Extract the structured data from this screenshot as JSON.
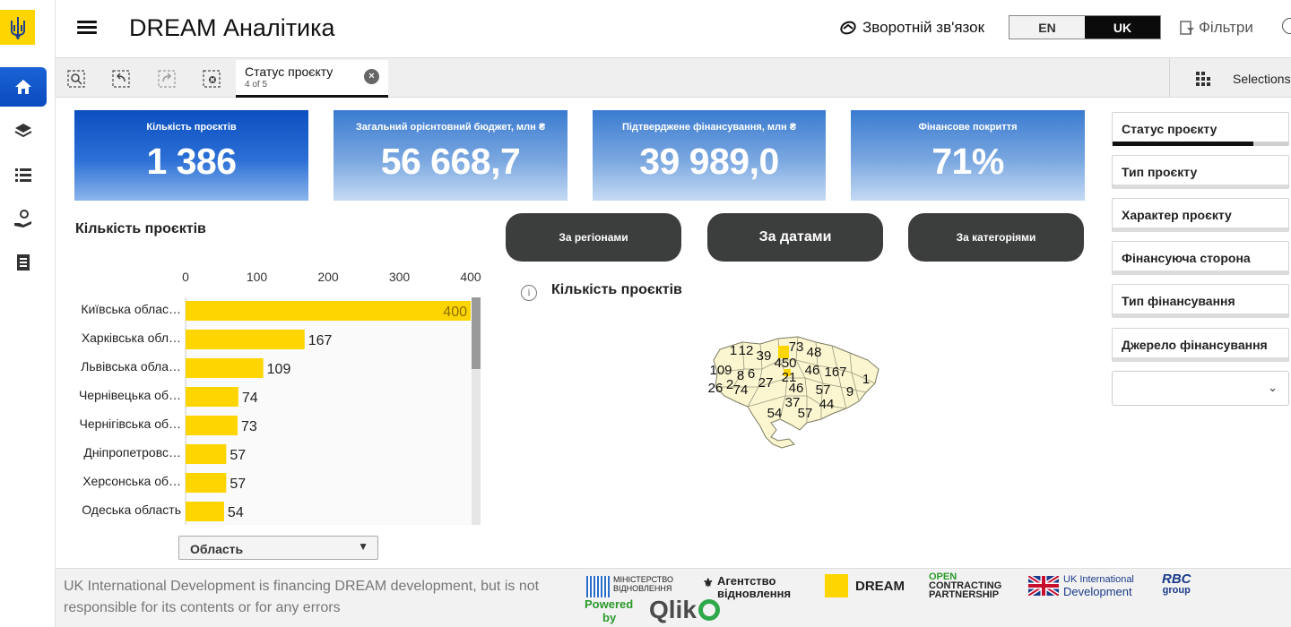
{
  "header": {
    "title": "DREAM Аналітика",
    "feedback": "Зворотній зв'язок",
    "lang_en": "EN",
    "lang_uk": "UK",
    "filters": "Фільтри"
  },
  "toolbar": {
    "tab_title": "Статус проєкту",
    "tab_sub": "4 of 5",
    "selections": "Selections"
  },
  "kpis": [
    {
      "title": "Кількість проєктів",
      "value": "1 386"
    },
    {
      "title": "Загальний орієнтовний бюджет, млн ₴",
      "value": "56 668,7"
    },
    {
      "title": "Підтверджене фінансування, млн ₴",
      "value": "39 989,0"
    },
    {
      "title": "Фінансове покриття",
      "value": "71%"
    }
  ],
  "bar_section": {
    "title": "Кількість проєктів",
    "dimension_select": "Область"
  },
  "buttons": {
    "regions": "За регіонами",
    "dates": "За датами",
    "categories": "За категоріями"
  },
  "map": {
    "title": "Кількість проєктів",
    "labels": [
      "1",
      "12",
      "39",
      "450",
      "73",
      "48",
      "109",
      "8",
      "6",
      "21",
      "46",
      "167",
      "26",
      "2",
      "74",
      "27",
      "46",
      "57",
      "9",
      "1",
      "37",
      "44",
      "54",
      "57"
    ]
  },
  "filters_panel": {
    "items": [
      "Статус проєкту",
      "Тип проєкту",
      "Характер проєкту",
      "Фінансуюча сторона",
      "Тип фінансування",
      "Джерело фінансування"
    ]
  },
  "footer": {
    "disclaimer": "UK International Development is financing DREAM development, but is not responsible for its contents or for any errors",
    "logo_ministry_1": "МІНІСТЕРСТВО",
    "logo_ministry_2": "ВІДНОВЛЕННЯ",
    "logo_agency_1": "Агентство",
    "logo_agency_2": "відновлення",
    "logo_dream": "DREAM",
    "logo_ocp_1": "OPEN",
    "logo_ocp_2": "CONTRACTING",
    "logo_ocp_3": "PARTNERSHIP",
    "logo_ukid_1": "UK International",
    "logo_ukid_2": "Development",
    "logo_rbc_1": "RBC",
    "logo_rbc_2": "group",
    "powered_1": "Powered",
    "powered_2": "by",
    "qlik": "Qlik"
  },
  "colors": {
    "bar": "#FFD500",
    "kpi_primary": "#0b4fc0",
    "pill": "#3c3d3d",
    "logo_bg": "#FFD500"
  },
  "chart_data": {
    "type": "bar",
    "orientation": "horizontal",
    "categories": [
      "Київська облас…",
      "Харківська обл…",
      "Львівська обла…",
      "Чернівецька об…",
      "Чернігівська об…",
      "Дніпропетровс…",
      "Херсонська об…",
      "Одеська область"
    ],
    "values": [
      400,
      167,
      109,
      74,
      73,
      57,
      57,
      54
    ],
    "xticks": [
      0,
      100,
      200,
      300,
      400
    ],
    "xlim": [
      0,
      400
    ],
    "grid": false
  }
}
